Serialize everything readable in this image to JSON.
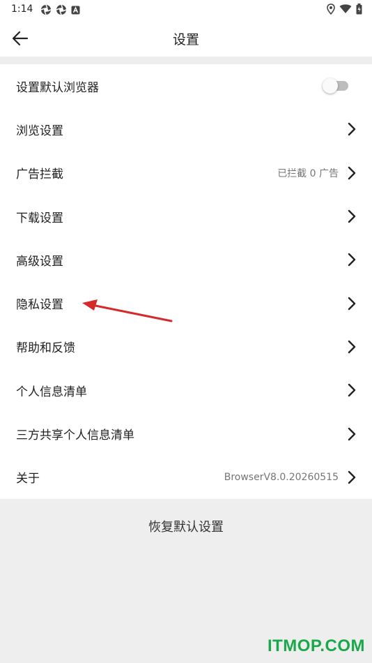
{
  "statusbar": {
    "time": "1:14"
  },
  "toolbar": {
    "title": "设置"
  },
  "settings": {
    "items": [
      {
        "label": "设置默认浏览器",
        "value": "",
        "control": "toggle",
        "toggle_on": false
      },
      {
        "label": "浏览设置",
        "value": "",
        "control": "chevron"
      },
      {
        "label": "广告拦截",
        "value": "已拦截 0 广告",
        "control": "chevron"
      },
      {
        "label": "下载设置",
        "value": "",
        "control": "chevron"
      },
      {
        "label": "高级设置",
        "value": "",
        "control": "chevron"
      },
      {
        "label": "隐私设置",
        "value": "",
        "control": "chevron"
      },
      {
        "label": "帮助和反馈",
        "value": "",
        "control": "chevron"
      },
      {
        "label": "个人信息清单",
        "value": "",
        "control": "chevron"
      },
      {
        "label": "三方共享个人信息清单",
        "value": "",
        "control": "chevron"
      },
      {
        "label": "关于",
        "value": "BrowserV8.0.20260515",
        "control": "chevron"
      }
    ]
  },
  "footer": {
    "reset_label": "恢复默认设置"
  },
  "watermark": {
    "text": "ITMOP.COM",
    "color": "#1aa84a"
  },
  "annotation": {
    "arrow_color": "#d62a2a",
    "points_to": "隐私设置"
  },
  "colors": {
    "background": "#eeeeee",
    "surface": "#ffffff",
    "secondary_text": "#757575"
  }
}
